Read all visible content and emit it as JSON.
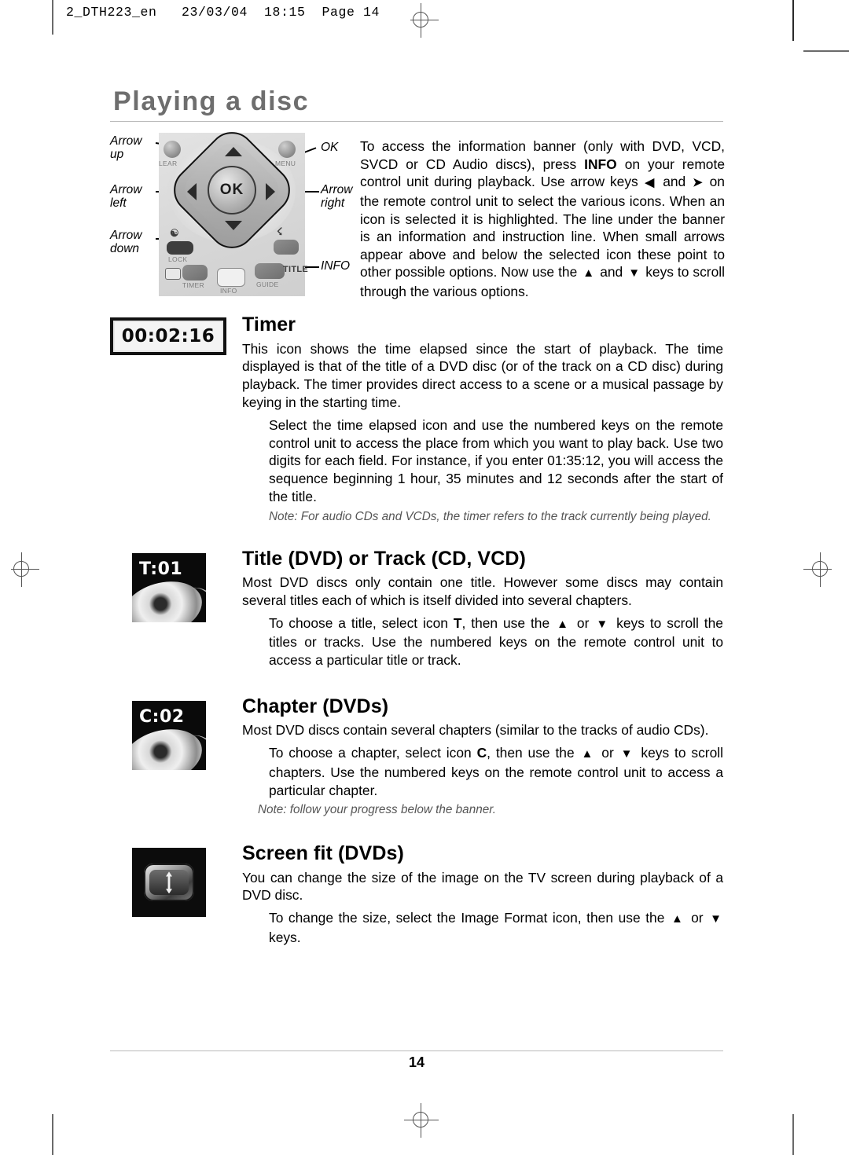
{
  "print_slug": "2_DTH223_en   23/03/04  18:15  Page 14",
  "page_title": "Playing a disc",
  "remote": {
    "callouts": {
      "arrow_up": "Arrow\nup",
      "arrow_left": "Arrow\nleft",
      "arrow_down": "Arrow\ndown",
      "ok": "OK",
      "arrow_right": "Arrow\nright",
      "info": "INFO"
    },
    "key_labels": {
      "clear": "LEAR",
      "menu": "MENU",
      "lock": "LOCK",
      "timer": "TIMER",
      "info": "INFO",
      "guide": "GUIDE",
      "title": "TITLE",
      "ok": "OK"
    }
  },
  "intro": {
    "part1": "To access the information banner (only with DVD, VCD, SVCD or CD Audio discs), press ",
    "info_bold": "INFO",
    "part2": " on your remote control unit during playback. Use arrow keys ",
    "left_arrow": "◀",
    "part3": " and ",
    "right_arrow": "➤",
    "part4": " on the remote control unit to select the various icons. When an icon is selected it is highlighted. The line under the banner is an information and instruction line. When small arrows appear above and below the selected icon these point to other possible options. Now use the ",
    "up_arrow": "▲",
    "part5": " and ",
    "down_arrow": "▼",
    "part6": " keys to scroll through the various options."
  },
  "sections": [
    {
      "id": "timer",
      "icon_text": "00:02:16",
      "heading": "Timer",
      "body": "This icon shows the time elapsed since the start of playback. The time displayed is that of the title of a DVD disc (or of the track on a CD disc) during playback. The timer provides direct access to a scene or a musical passage by keying in the starting time.",
      "indent": "Select the time elapsed icon and use the numbered keys on the remote control unit to access the place from which you want to play back. Use two digits for each field. For instance, if you enter 01:35:12, you will access the sequence beginning 1 hour, 35 minutes and 12 seconds after the start of the title.",
      "note": "Note: For audio CDs and VCDs, the timer refers to the track currently being played."
    },
    {
      "id": "title",
      "icon_text": "T:01",
      "heading": "Title (DVD) or Track (CD, VCD)",
      "body": "Most DVD discs only contain one title. However some discs may contain several titles each of which is itself divided into several chapters.",
      "indent_a": "To choose a title, select icon ",
      "indent_bold": "T",
      "indent_b": ", then use the ",
      "up_arrow": "▲",
      "indent_c": " or ",
      "down_arrow": "▼",
      "indent_d": " keys to scroll the titles or tracks. Use the numbered keys on the remote control unit to access a particular title or track."
    },
    {
      "id": "chapter",
      "icon_text": "C:02",
      "heading": "Chapter (DVDs)",
      "body": "Most DVD discs contain several chapters (similar to the tracks of audio CDs).",
      "indent_a": "To choose a chapter, select icon ",
      "indent_bold": "C",
      "indent_b": ", then use the ",
      "up_arrow": "▲",
      "indent_c": " or ",
      "down_arrow": "▼",
      "indent_d": " keys to scroll chapters. Use the numbered keys on the remote control unit to access a particular chapter.",
      "note": "Note: follow your progress below the banner."
    },
    {
      "id": "screenfit",
      "icon_text": "",
      "heading": "Screen fit (DVDs)",
      "body": "You can change the size of the image on the TV screen during playback of a DVD disc.",
      "indent_a": "To change the size, select the Image Format icon, then use the ",
      "up_arrow": "▲",
      "indent_c": " or ",
      "down_arrow": "▼",
      "indent_d": " keys."
    }
  ],
  "footer": {
    "page_number": "14"
  },
  "colors": {
    "title_gray": "#6e6e6e",
    "rule_gray": "#b9b9b9",
    "note_gray": "#555555",
    "mark_gray": "#555555"
  }
}
